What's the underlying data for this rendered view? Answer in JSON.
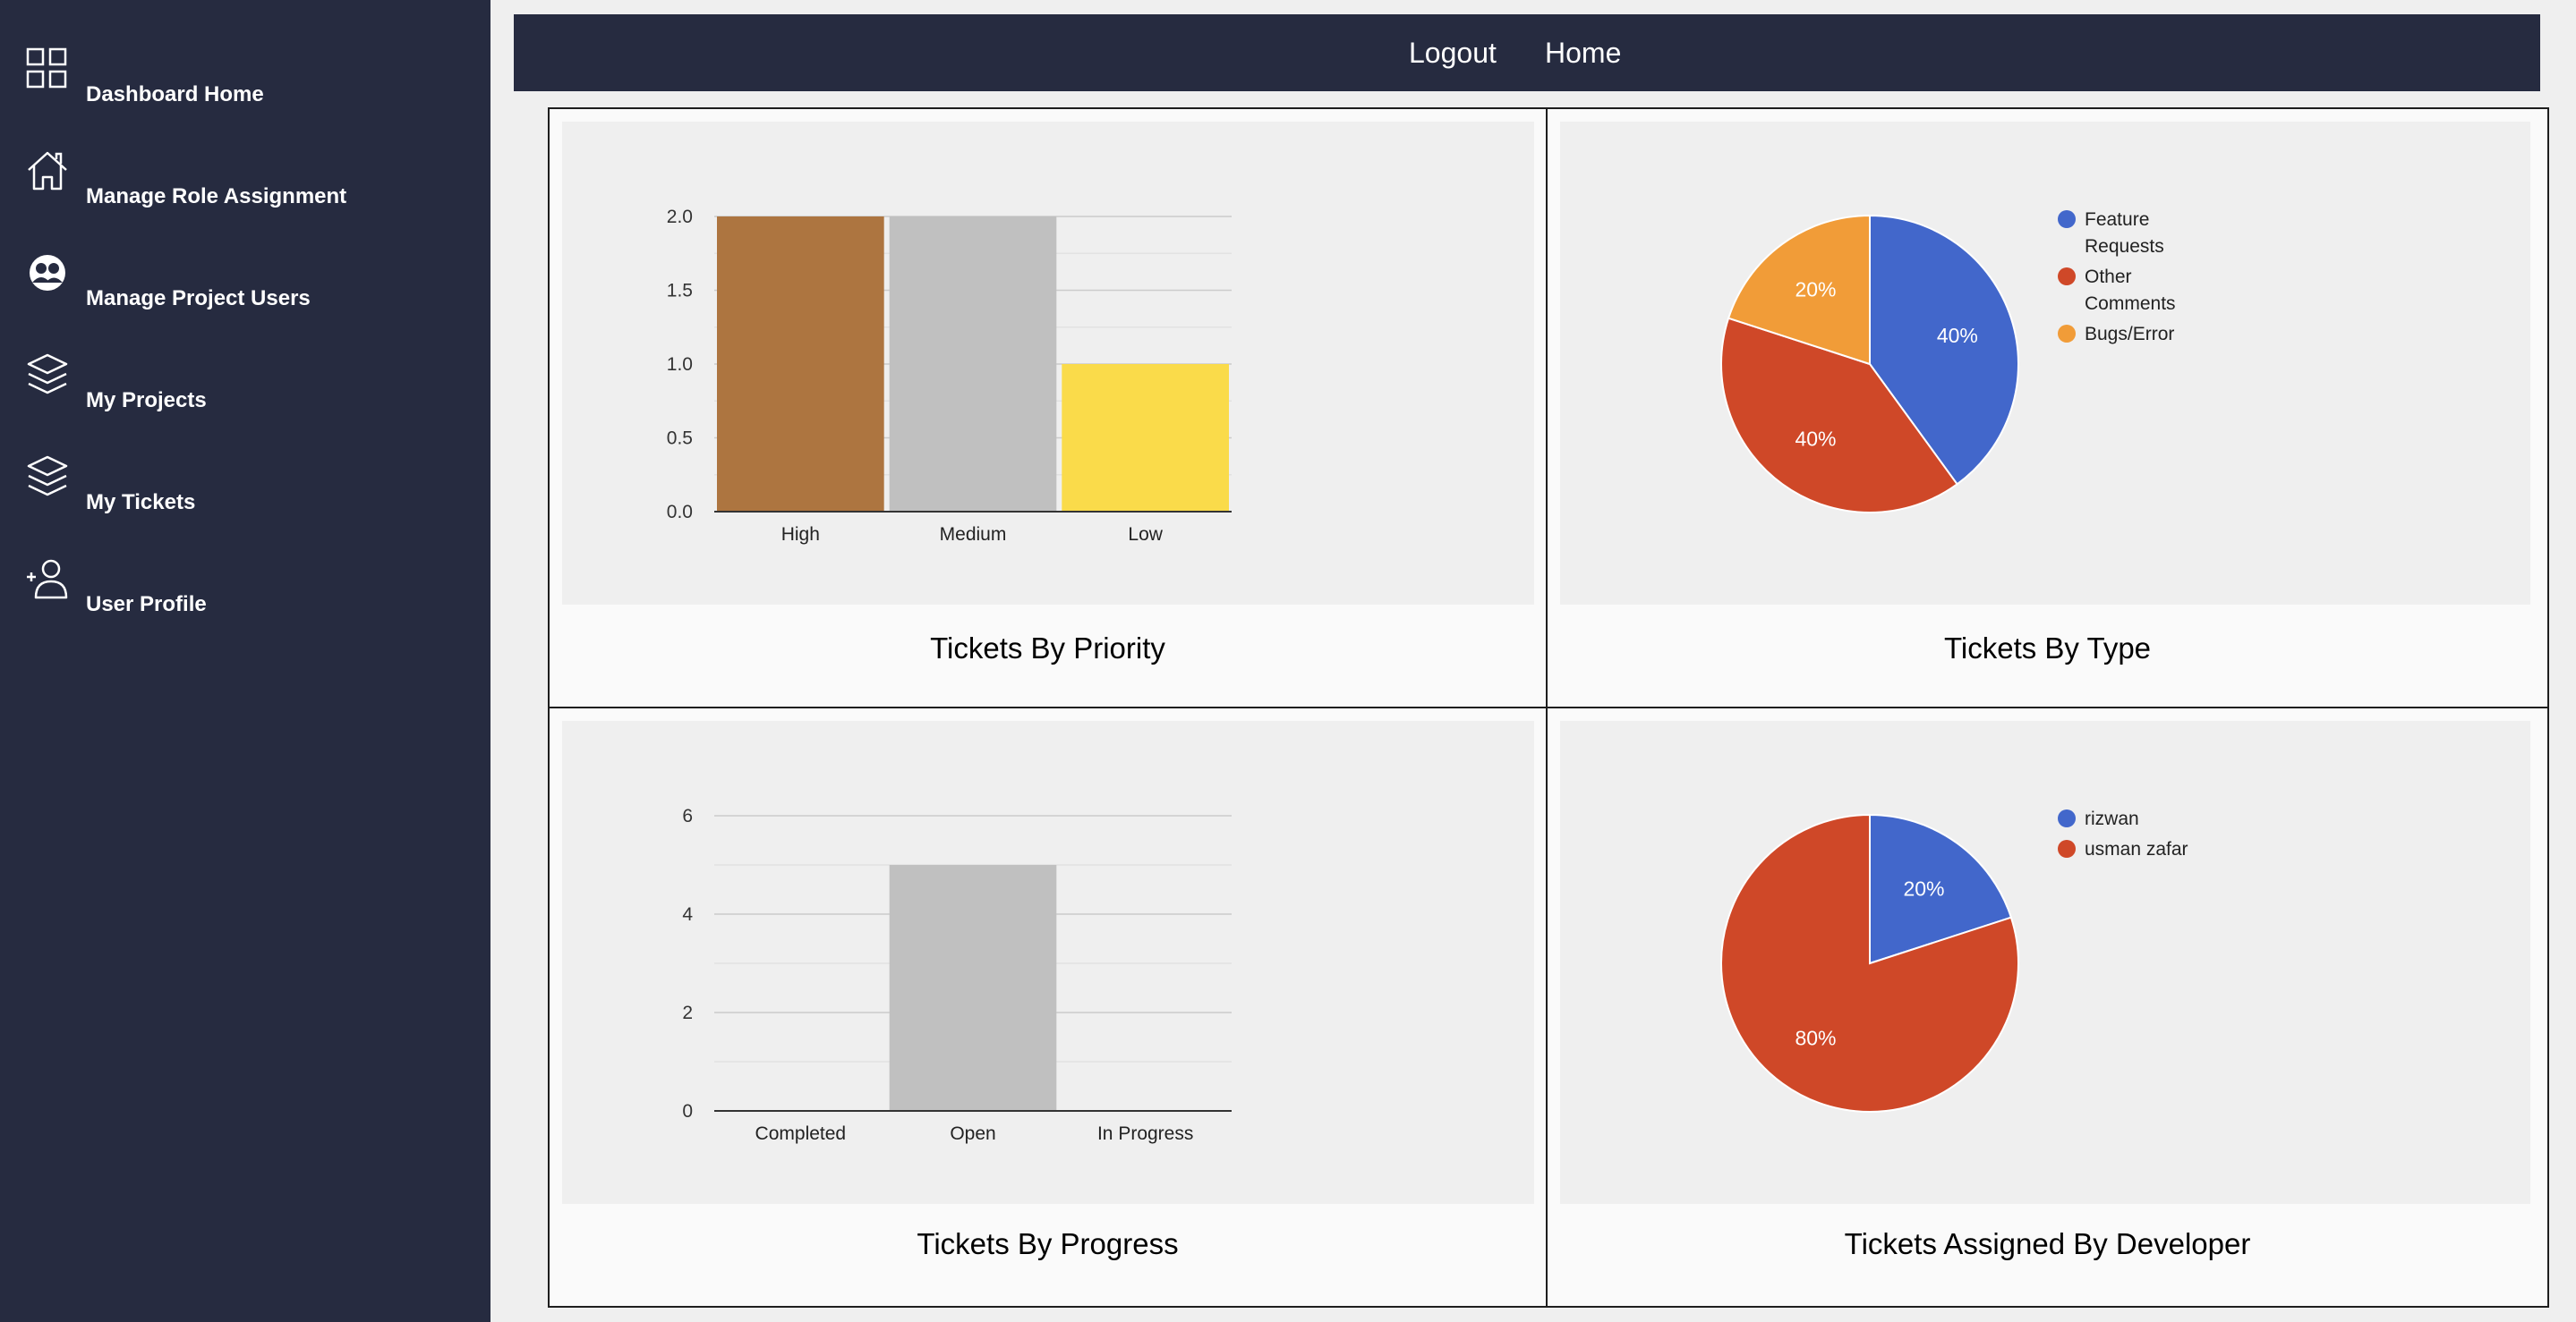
{
  "sidebar": {
    "items": [
      {
        "label": "Dashboard Home",
        "icon": "grid-icon"
      },
      {
        "label": "Manage Role Assignment",
        "icon": "home-icon"
      },
      {
        "label": "Manage Project Users",
        "icon": "users-icon"
      },
      {
        "label": "My Projects",
        "icon": "layers-icon"
      },
      {
        "label": "My Tickets",
        "icon": "layers-icon"
      },
      {
        "label": "User Profile",
        "icon": "add-user-icon"
      }
    ]
  },
  "header": {
    "logout_label": "Logout",
    "home_label": "Home"
  },
  "panels": [
    {
      "title": "Tickets By Priority"
    },
    {
      "title": "Tickets By Type"
    },
    {
      "title": "Tickets By Progress"
    },
    {
      "title": "Tickets Assigned By Developer"
    }
  ],
  "chart_data": [
    {
      "type": "bar",
      "title": "Tickets By Priority",
      "categories": [
        "High",
        "Medium",
        "Low"
      ],
      "values": [
        2,
        2,
        1
      ],
      "colors": [
        "#ad7540",
        "#c0c0c0",
        "#fadb4a"
      ],
      "ylim": [
        0,
        2
      ],
      "yticks": [
        "0.0",
        "0.5",
        "1.0",
        "1.5",
        "2.0"
      ],
      "grid": true
    },
    {
      "type": "pie",
      "title": "Tickets By Type",
      "labels": [
        "Feature Requests",
        "Other Comments",
        "Bugs/Error"
      ],
      "values": [
        40,
        40,
        20
      ],
      "slice_labels": [
        "40%",
        "40%",
        "20%"
      ],
      "colors": [
        "#4267cb",
        "#cf4828",
        "#f19c38"
      ],
      "legend": "right"
    },
    {
      "type": "bar",
      "title": "Tickets By Progress",
      "categories": [
        "Completed",
        "Open",
        "In Progress"
      ],
      "values": [
        0,
        5,
        0
      ],
      "colors": [
        "#ad7540",
        "#c0c0c0",
        "#fadb4a"
      ],
      "ylim": [
        0,
        6
      ],
      "yticks": [
        "0",
        "2",
        "4",
        "6"
      ],
      "grid": true
    },
    {
      "type": "pie",
      "title": "Tickets Assigned By Developer",
      "labels": [
        "rizwan",
        "usman zafar"
      ],
      "values": [
        20,
        80
      ],
      "slice_labels": [
        "20%",
        "80%"
      ],
      "colors": [
        "#4267cb",
        "#cf4828"
      ],
      "legend": "right"
    }
  ]
}
